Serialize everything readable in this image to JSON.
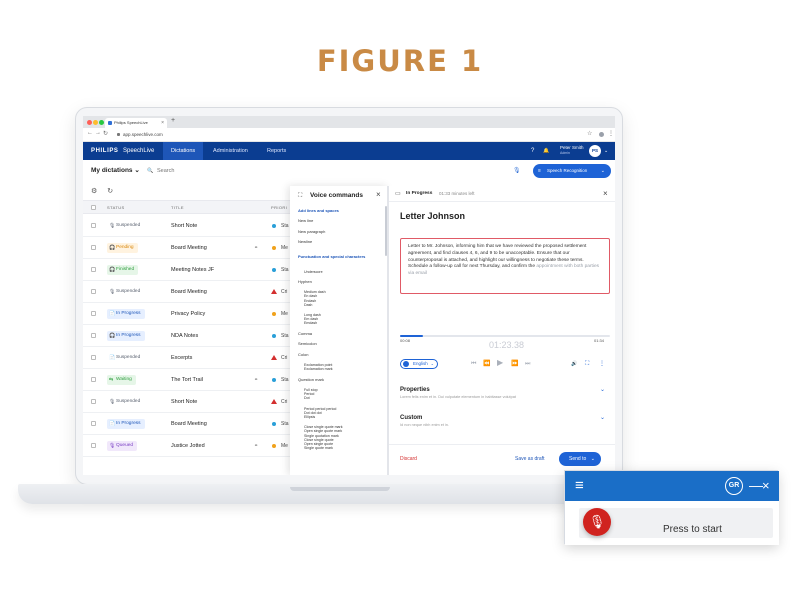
{
  "figure_title": "FIGURE 1",
  "colors": {
    "figure_title": "#c98a45",
    "brand_blue": "#0b3d91",
    "accent": "#1e63d6",
    "danger": "#d32f2f"
  },
  "browser": {
    "tab_title": "Philips SpeechLive",
    "tab_close": "×",
    "new_tab": "+",
    "url": "app.speechlive.com",
    "nav": {
      "back": "←",
      "forward": "→",
      "reload": "↻",
      "star": "☆",
      "menu": "⋮"
    }
  },
  "app": {
    "logo": "PHILIPS",
    "product": "SpeechLive",
    "nav": [
      {
        "label": "Dictations",
        "active": true
      },
      {
        "label": "Administration",
        "active": false
      },
      {
        "label": "Reports",
        "active": false
      }
    ],
    "help_icon": "?",
    "bell_icon": "🔔",
    "user": {
      "name": "Peter Smith",
      "role": "Admin",
      "initials": "PS"
    },
    "caret": "⌄"
  },
  "toolbar": {
    "heading": "My dictations ⌄",
    "search_placeholder": "Search",
    "search_icon": "🔍",
    "mic_icon": "🎙",
    "speech_button": "Speech Recognition",
    "speech_icon": "≡",
    "caret": "⌄",
    "filter_icon": "⚙",
    "refresh_icon": "↻"
  },
  "table": {
    "columns": [
      "STATUS",
      "TITLE",
      "PRIORI"
    ],
    "rows": [
      {
        "status": "Suspended",
        "status_icon": "🎙",
        "status_color": "#5a6270",
        "status_bg": "#ffffff",
        "title": "Short Note",
        "icon": "",
        "prio_shape": "dot",
        "prio_color": "#2a9fd8",
        "prio_label": "Sta"
      },
      {
        "status": "Pending",
        "status_icon": "🎧",
        "status_color": "#d8860b",
        "status_bg": "#fff3e0",
        "title": "Board Meeting",
        "icon": "⚭",
        "prio_shape": "dot",
        "prio_color": "#f0a21b",
        "prio_label": "Me"
      },
      {
        "status": "Finished",
        "status_icon": "🎧",
        "status_color": "#2e9e3e",
        "status_bg": "#e6f6e8",
        "title": "Meeting Notes JF",
        "icon": "",
        "prio_shape": "dot",
        "prio_color": "#2a9fd8",
        "prio_label": "Sta"
      },
      {
        "status": "Suspended",
        "status_icon": "🎙",
        "status_color": "#5a6270",
        "status_bg": "#ffffff",
        "title": "Board Meeting",
        "icon": "",
        "prio_shape": "tri",
        "prio_color": "#d32f2f",
        "prio_label": "Cri"
      },
      {
        "status": "In Progress",
        "status_icon": "📄",
        "status_color": "#1e56b8",
        "status_bg": "#e6efff",
        "title": "Privacy Policy",
        "icon": "",
        "prio_shape": "dot",
        "prio_color": "#f0a21b",
        "prio_label": "Me"
      },
      {
        "status": "In Progress",
        "status_icon": "🎧",
        "status_color": "#1e56b8",
        "status_bg": "#e6efff",
        "title": "NDA Notes",
        "icon": "",
        "prio_shape": "dot",
        "prio_color": "#2a9fd8",
        "prio_label": "Sta"
      },
      {
        "status": "Suspended",
        "status_icon": "📄",
        "status_color": "#5a6270",
        "status_bg": "#ffffff",
        "title": "Excerpts",
        "icon": "",
        "prio_shape": "tri",
        "prio_color": "#d32f2f",
        "prio_label": "Cri"
      },
      {
        "status": "Waiting",
        "status_icon": "⇆",
        "status_color": "#2e9e3e",
        "status_bg": "#e6f6e8",
        "title": "The Tort Trail",
        "icon": "⚭",
        "prio_shape": "dot",
        "prio_color": "#2a9fd8",
        "prio_label": "Sta"
      },
      {
        "status": "Suspended",
        "status_icon": "🎙",
        "status_color": "#5a6270",
        "status_bg": "#ffffff",
        "title": "Short Note",
        "icon": "",
        "prio_shape": "tri",
        "prio_color": "#d32f2f",
        "prio_label": "Cri"
      },
      {
        "status": "In Progress",
        "status_icon": "📄",
        "status_color": "#1e56b8",
        "status_bg": "#e6efff",
        "title": "Board Meeting",
        "icon": "",
        "prio_shape": "dot",
        "prio_color": "#2a9fd8",
        "prio_label": "Sta"
      },
      {
        "status": "Queued",
        "status_icon": "🎙",
        "status_color": "#7a3fc4",
        "status_bg": "#f1e8fb",
        "title": "Justice Jotted",
        "icon": "⚭",
        "prio_shape": "dot",
        "prio_color": "#f0a21b",
        "prio_label": "Me"
      }
    ]
  },
  "voice_commands": {
    "title": "Voice commands",
    "icon": "⛶",
    "close": "×",
    "entries": [
      {
        "kind": "sec",
        "text": "Add lines and spaces"
      },
      {
        "kind": "item",
        "text": "New line"
      },
      {
        "kind": "item",
        "text": "New paragraph"
      },
      {
        "kind": "item",
        "text": "Newline"
      },
      {
        "kind": "sec",
        "text": "Punctuation and special characters"
      },
      {
        "kind": "sub",
        "text": "Underscore"
      },
      {
        "kind": "item",
        "text": "Hyphen"
      },
      {
        "kind": "sub",
        "text": "Medium dash\nEn dash\nEndash\nDash"
      },
      {
        "kind": "sub",
        "text": "Long dash\nEm dash\nEmdash"
      },
      {
        "kind": "item",
        "text": "Comma"
      },
      {
        "kind": "item",
        "text": "Semicolon"
      },
      {
        "kind": "item",
        "text": "Colon"
      },
      {
        "kind": "sub",
        "text": "Exclamation point\nExclamation mark"
      },
      {
        "kind": "item",
        "text": "Question mark"
      },
      {
        "kind": "sub",
        "text": "Full stop\nPeriod\nDot"
      },
      {
        "kind": "sub",
        "text": "Period period period\nDot dot dot\nEllipsis"
      },
      {
        "kind": "sub",
        "text": "Close single quote mark\nOpen single quote mark\nSingle quotation mark\nClose single quote\nOpen single quote\nSingle quote mark"
      }
    ]
  },
  "editor": {
    "state": "In Progress",
    "state_icon": "▭",
    "time_left": "01:33 minutes left",
    "close": "×",
    "title": "Letter Johnson",
    "body_main": "Letter to Mr. Johnson, informing him that we have reviewed the proposed settlement agreement, and find clauses 4, 6, and 9 to be unacceptable. Ensure that our counterproposal is attached, and highlight our willingness to negotiate these terms. Schedule a follow-up call for next Thursday, and confirm the",
    "body_faded": "appointment with both parties via email",
    "progress": 0.11,
    "time_start": "00:08",
    "time_current": "01:23.38",
    "time_end": "01:34",
    "language": "English",
    "lang_caret": "⌄",
    "playback_icons": [
      "⏮",
      "⏪",
      "▶",
      "⏩",
      "⏭"
    ],
    "tool_icons": [
      "🔊",
      "⛶",
      "⋮"
    ],
    "sections": [
      {
        "title": "Properties",
        "sub": "Lorem felis enim et in. Dui vulputate elementum in habitasse volutpat",
        "chev": "⌄"
      },
      {
        "title": "Custom",
        "sub": "Id non neque nibh enim et in.",
        "chev": "⌄"
      }
    ],
    "discard": "Discard",
    "save_draft": "Save as draft",
    "send": "Send to",
    "send_caret": "⌄"
  },
  "widget": {
    "menu_icon": "≡",
    "avatar": "GR",
    "minimize": "—",
    "close": "×",
    "mic_icon": "🎙",
    "press_label": "Press to start"
  }
}
